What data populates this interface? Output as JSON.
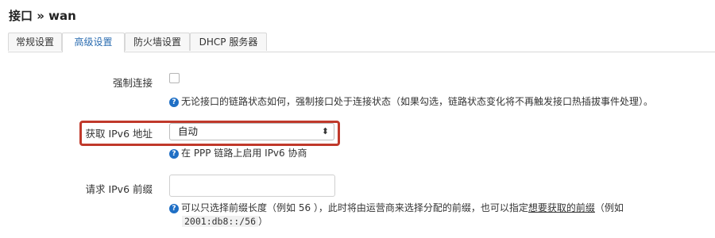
{
  "page": {
    "title": "接口 » wan"
  },
  "tabs": [
    {
      "label": "常规设置",
      "active": false
    },
    {
      "label": "高级设置",
      "active": true
    },
    {
      "label": "防火墙设置",
      "active": false
    },
    {
      "label": "DHCP 服务器",
      "active": false
    }
  ],
  "force_link": {
    "label": "强制连接",
    "checked": false,
    "help": "无论接口的链路状态如何，强制接口处于连接状态（如果勾选，链路状态变化将不再触发接口热插拔事件处理）。"
  },
  "ipv6_address": {
    "label": "获取 IPv6 地址",
    "value": "自动",
    "help": "在 PPP 链路上启用 IPv6 协商"
  },
  "ipv6_prefix": {
    "label": "请求 IPv6 前缀",
    "value": "",
    "help_a": "可以只选择前缀长度（例如 56 ），此时将由运营商来选择分配的前缀，也可以指定",
    "help_link": "想要获取的前缀",
    "help_b": "（例如",
    "help_code": "2001:db8::/56",
    "help_c": "）"
  },
  "colors": {
    "accent": "#2b6cb0",
    "highlight": "#c0392b",
    "help_icon": "#1f6fc5"
  }
}
